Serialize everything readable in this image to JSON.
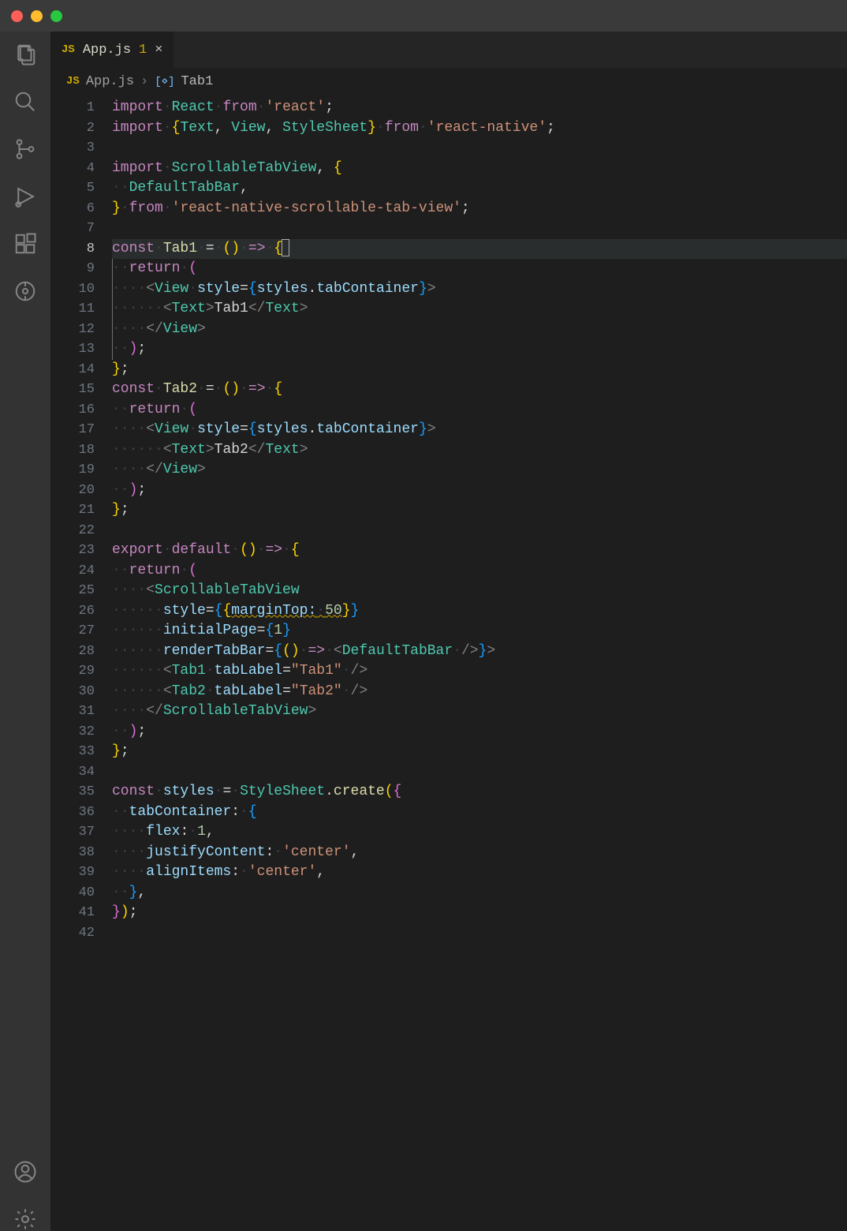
{
  "tab": {
    "icon_label": "JS",
    "filename": "App.js",
    "modified_badge": "1",
    "close_glyph": "×"
  },
  "breadcrumb": {
    "icon_label": "JS",
    "filename": "App.js",
    "separator": "›",
    "symbol_icon": "[⋄]",
    "symbol": "Tab1"
  },
  "gutter": {
    "line_count": 42,
    "current_line": 8
  },
  "code": {
    "lines": [
      {
        "n": 1,
        "seg": [
          [
            "kw",
            "import"
          ],
          [
            "ws",
            " "
          ],
          [
            "ty",
            "React"
          ],
          [
            "ws",
            " "
          ],
          [
            "kw",
            "from"
          ],
          [
            "ws",
            " "
          ],
          [
            "st",
            "'react'"
          ],
          [
            "pn",
            ";"
          ]
        ]
      },
      {
        "n": 2,
        "seg": [
          [
            "kw",
            "import"
          ],
          [
            "ws",
            " "
          ],
          [
            "br",
            "{"
          ],
          [
            "ty",
            "Text"
          ],
          [
            "pn",
            ", "
          ],
          [
            "ty",
            "View"
          ],
          [
            "pn",
            ", "
          ],
          [
            "ty",
            "StyleSheet"
          ],
          [
            "br",
            "}"
          ],
          [
            "ws",
            " "
          ],
          [
            "kw",
            "from"
          ],
          [
            "ws",
            " "
          ],
          [
            "st",
            "'react-native'"
          ],
          [
            "pn",
            ";"
          ]
        ]
      },
      {
        "n": 3,
        "seg": []
      },
      {
        "n": 4,
        "seg": [
          [
            "kw",
            "import"
          ],
          [
            "ws",
            " "
          ],
          [
            "ty",
            "ScrollableTabView"
          ],
          [
            "pn",
            ", "
          ],
          [
            "br",
            "{"
          ]
        ]
      },
      {
        "n": 5,
        "seg": [
          [
            "ws",
            "  "
          ],
          [
            "ty",
            "DefaultTabBar"
          ],
          [
            "pn",
            ","
          ]
        ]
      },
      {
        "n": 6,
        "seg": [
          [
            "br",
            "}"
          ],
          [
            "ws",
            " "
          ],
          [
            "kw",
            "from"
          ],
          [
            "ws",
            " "
          ],
          [
            "st",
            "'react-native-scrollable-tab-view'"
          ],
          [
            "pn",
            ";"
          ]
        ]
      },
      {
        "n": 7,
        "seg": []
      },
      {
        "n": 8,
        "hl": true,
        "cursor_after": true,
        "seg": [
          [
            "kw",
            "const"
          ],
          [
            "ws",
            " "
          ],
          [
            "fn",
            "Tab1"
          ],
          [
            "ws",
            " "
          ],
          [
            "op",
            "="
          ],
          [
            "ws",
            " "
          ],
          [
            "br",
            "("
          ],
          [
            "br",
            ")"
          ],
          [
            "ws",
            " "
          ],
          [
            "kw",
            "=>"
          ],
          [
            "ws",
            " "
          ],
          [
            "br",
            "{"
          ]
        ]
      },
      {
        "n": 9,
        "ig": true,
        "seg": [
          [
            "ws",
            "  "
          ],
          [
            "kw",
            "return"
          ],
          [
            "ws",
            " "
          ],
          [
            "br2",
            "("
          ]
        ]
      },
      {
        "n": 10,
        "ig": true,
        "seg": [
          [
            "ws",
            "    "
          ],
          [
            "tg",
            "<"
          ],
          [
            "ty",
            "View"
          ],
          [
            "ws",
            " "
          ],
          [
            "va",
            "style"
          ],
          [
            "op",
            "="
          ],
          [
            "br3",
            "{"
          ],
          [
            "va",
            "styles"
          ],
          [
            "pn",
            "."
          ],
          [
            "va",
            "tabContainer"
          ],
          [
            "br3",
            "}"
          ],
          [
            "tg",
            ">"
          ]
        ]
      },
      {
        "n": 11,
        "ig": true,
        "seg": [
          [
            "ws",
            "      "
          ],
          [
            "tg",
            "<"
          ],
          [
            "ty",
            "Text"
          ],
          [
            "tg",
            ">"
          ],
          [
            "pn",
            "Tab1"
          ],
          [
            "tg",
            "</"
          ],
          [
            "ty",
            "Text"
          ],
          [
            "tg",
            ">"
          ]
        ]
      },
      {
        "n": 12,
        "ig": true,
        "seg": [
          [
            "ws",
            "    "
          ],
          [
            "tg",
            "</"
          ],
          [
            "ty",
            "View"
          ],
          [
            "tg",
            ">"
          ]
        ]
      },
      {
        "n": 13,
        "ig": true,
        "seg": [
          [
            "ws",
            "  "
          ],
          [
            "br2",
            ")"
          ],
          [
            "pn",
            ";"
          ]
        ]
      },
      {
        "n": 14,
        "seg": [
          [
            "br",
            "}"
          ],
          [
            "pn",
            ";"
          ]
        ]
      },
      {
        "n": 15,
        "seg": [
          [
            "kw",
            "const"
          ],
          [
            "ws",
            " "
          ],
          [
            "fn",
            "Tab2"
          ],
          [
            "ws",
            " "
          ],
          [
            "op",
            "="
          ],
          [
            "ws",
            " "
          ],
          [
            "br",
            "("
          ],
          [
            "br",
            ")"
          ],
          [
            "ws",
            " "
          ],
          [
            "kw",
            "=>"
          ],
          [
            "ws",
            " "
          ],
          [
            "br",
            "{"
          ]
        ]
      },
      {
        "n": 16,
        "seg": [
          [
            "ws",
            "  "
          ],
          [
            "kw",
            "return"
          ],
          [
            "ws",
            " "
          ],
          [
            "br2",
            "("
          ]
        ]
      },
      {
        "n": 17,
        "seg": [
          [
            "ws",
            "    "
          ],
          [
            "tg",
            "<"
          ],
          [
            "ty",
            "View"
          ],
          [
            "ws",
            " "
          ],
          [
            "va",
            "style"
          ],
          [
            "op",
            "="
          ],
          [
            "br3",
            "{"
          ],
          [
            "va",
            "styles"
          ],
          [
            "pn",
            "."
          ],
          [
            "va",
            "tabContainer"
          ],
          [
            "br3",
            "}"
          ],
          [
            "tg",
            ">"
          ]
        ]
      },
      {
        "n": 18,
        "seg": [
          [
            "ws",
            "      "
          ],
          [
            "tg",
            "<"
          ],
          [
            "ty",
            "Text"
          ],
          [
            "tg",
            ">"
          ],
          [
            "pn",
            "Tab2"
          ],
          [
            "tg",
            "</"
          ],
          [
            "ty",
            "Text"
          ],
          [
            "tg",
            ">"
          ]
        ]
      },
      {
        "n": 19,
        "seg": [
          [
            "ws",
            "    "
          ],
          [
            "tg",
            "</"
          ],
          [
            "ty",
            "View"
          ],
          [
            "tg",
            ">"
          ]
        ]
      },
      {
        "n": 20,
        "seg": [
          [
            "ws",
            "  "
          ],
          [
            "br2",
            ")"
          ],
          [
            "pn",
            ";"
          ]
        ]
      },
      {
        "n": 21,
        "seg": [
          [
            "br",
            "}"
          ],
          [
            "pn",
            ";"
          ]
        ]
      },
      {
        "n": 22,
        "seg": []
      },
      {
        "n": 23,
        "seg": [
          [
            "kw",
            "export"
          ],
          [
            "ws",
            " "
          ],
          [
            "kw",
            "default"
          ],
          [
            "ws",
            " "
          ],
          [
            "br",
            "("
          ],
          [
            "br",
            ")"
          ],
          [
            "ws",
            " "
          ],
          [
            "kw",
            "=>"
          ],
          [
            "ws",
            " "
          ],
          [
            "br",
            "{"
          ]
        ]
      },
      {
        "n": 24,
        "seg": [
          [
            "ws",
            "  "
          ],
          [
            "kw",
            "return"
          ],
          [
            "ws",
            " "
          ],
          [
            "br2",
            "("
          ]
        ]
      },
      {
        "n": 25,
        "seg": [
          [
            "ws",
            "    "
          ],
          [
            "tg",
            "<"
          ],
          [
            "ty",
            "ScrollableTabView"
          ]
        ]
      },
      {
        "n": 26,
        "seg": [
          [
            "ws",
            "      "
          ],
          [
            "va",
            "style"
          ],
          [
            "op",
            "="
          ],
          [
            "br3",
            "{"
          ],
          [
            "br",
            "{"
          ],
          [
            "va squig",
            "marginTop:"
          ],
          [
            "ws squig",
            " "
          ],
          [
            "nm squig",
            "50"
          ],
          [
            "br",
            "}"
          ],
          [
            "br3",
            "}"
          ]
        ]
      },
      {
        "n": 27,
        "seg": [
          [
            "ws",
            "      "
          ],
          [
            "va",
            "initialPage"
          ],
          [
            "op",
            "="
          ],
          [
            "br3",
            "{"
          ],
          [
            "nm",
            "1"
          ],
          [
            "br3",
            "}"
          ]
        ]
      },
      {
        "n": 28,
        "seg": [
          [
            "ws",
            "      "
          ],
          [
            "va",
            "renderTabBar"
          ],
          [
            "op",
            "="
          ],
          [
            "br3",
            "{"
          ],
          [
            "br",
            "("
          ],
          [
            "br",
            ")"
          ],
          [
            "ws",
            " "
          ],
          [
            "kw",
            "=>"
          ],
          [
            "ws",
            " "
          ],
          [
            "tg",
            "<"
          ],
          [
            "ty",
            "DefaultTabBar"
          ],
          [
            "ws",
            " "
          ],
          [
            "tg",
            "/>"
          ],
          [
            "br3",
            "}"
          ],
          [
            "tg",
            ">"
          ]
        ]
      },
      {
        "n": 29,
        "seg": [
          [
            "ws",
            "      "
          ],
          [
            "tg",
            "<"
          ],
          [
            "ty",
            "Tab1"
          ],
          [
            "ws",
            " "
          ],
          [
            "va",
            "tabLabel"
          ],
          [
            "op",
            "="
          ],
          [
            "st",
            "\"Tab1\""
          ],
          [
            "ws",
            " "
          ],
          [
            "tg",
            "/>"
          ]
        ]
      },
      {
        "n": 30,
        "seg": [
          [
            "ws",
            "      "
          ],
          [
            "tg",
            "<"
          ],
          [
            "ty",
            "Tab2"
          ],
          [
            "ws",
            " "
          ],
          [
            "va",
            "tabLabel"
          ],
          [
            "op",
            "="
          ],
          [
            "st",
            "\"Tab2\""
          ],
          [
            "ws",
            " "
          ],
          [
            "tg",
            "/>"
          ]
        ]
      },
      {
        "n": 31,
        "seg": [
          [
            "ws",
            "    "
          ],
          [
            "tg",
            "</"
          ],
          [
            "ty",
            "ScrollableTabView"
          ],
          [
            "tg",
            ">"
          ]
        ]
      },
      {
        "n": 32,
        "seg": [
          [
            "ws",
            "  "
          ],
          [
            "br2",
            ")"
          ],
          [
            "pn",
            ";"
          ]
        ]
      },
      {
        "n": 33,
        "seg": [
          [
            "br",
            "}"
          ],
          [
            "pn",
            ";"
          ]
        ]
      },
      {
        "n": 34,
        "seg": []
      },
      {
        "n": 35,
        "seg": [
          [
            "kw",
            "const"
          ],
          [
            "ws",
            " "
          ],
          [
            "va",
            "styles"
          ],
          [
            "ws",
            " "
          ],
          [
            "op",
            "="
          ],
          [
            "ws",
            " "
          ],
          [
            "ty",
            "StyleSheet"
          ],
          [
            "pn",
            "."
          ],
          [
            "fn",
            "create"
          ],
          [
            "br",
            "("
          ],
          [
            "br2",
            "{"
          ]
        ]
      },
      {
        "n": 36,
        "seg": [
          [
            "ws",
            "  "
          ],
          [
            "va",
            "tabContainer"
          ],
          [
            "pn",
            ":"
          ],
          [
            "ws",
            " "
          ],
          [
            "br3",
            "{"
          ]
        ]
      },
      {
        "n": 37,
        "seg": [
          [
            "ws",
            "    "
          ],
          [
            "va",
            "flex"
          ],
          [
            "pn",
            ":"
          ],
          [
            "ws",
            " "
          ],
          [
            "nm",
            "1"
          ],
          [
            "pn",
            ","
          ]
        ]
      },
      {
        "n": 38,
        "seg": [
          [
            "ws",
            "    "
          ],
          [
            "va",
            "justifyContent"
          ],
          [
            "pn",
            ":"
          ],
          [
            "ws",
            " "
          ],
          [
            "st",
            "'center'"
          ],
          [
            "pn",
            ","
          ]
        ]
      },
      {
        "n": 39,
        "seg": [
          [
            "ws",
            "    "
          ],
          [
            "va",
            "alignItems"
          ],
          [
            "pn",
            ":"
          ],
          [
            "ws",
            " "
          ],
          [
            "st",
            "'center'"
          ],
          [
            "pn",
            ","
          ]
        ]
      },
      {
        "n": 40,
        "seg": [
          [
            "ws",
            "  "
          ],
          [
            "br3",
            "}"
          ],
          [
            "pn",
            ","
          ]
        ]
      },
      {
        "n": 41,
        "seg": [
          [
            "br2",
            "}"
          ],
          [
            "br",
            ")"
          ],
          [
            "pn",
            ";"
          ]
        ]
      },
      {
        "n": 42,
        "seg": []
      }
    ]
  }
}
